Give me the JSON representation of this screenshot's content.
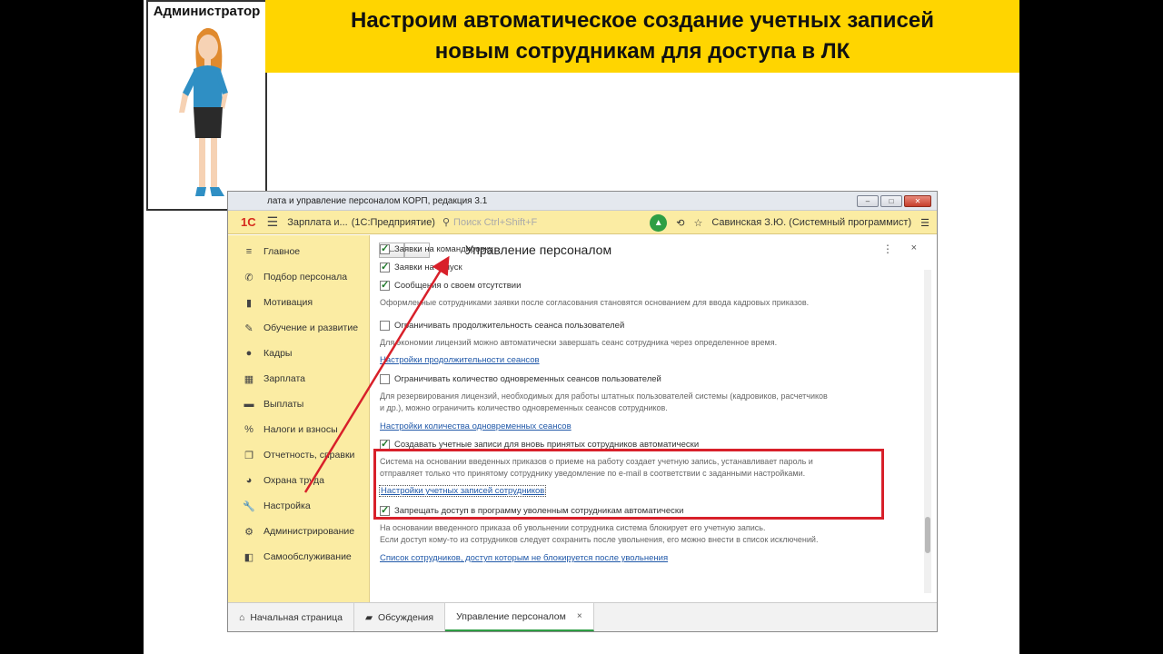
{
  "banner": {
    "line1": "Настроим автоматическое создание учетных записей",
    "line2": "новым сотрудникам для доступа в ЛК"
  },
  "admin_label": "Администратор",
  "window": {
    "title": "лата и управление персоналом КОРП, редакция 3.1",
    "buttons": [
      "‒",
      "□",
      "✕"
    ]
  },
  "toolbar": {
    "logo": "1С",
    "app_name": "Зарплата и...",
    "app_kind": "(1С:Предприятие)",
    "search_placeholder": "Поиск Ctrl+Shift+F",
    "user": "Савинская З.Ю. (Системный программист)"
  },
  "sidebar": {
    "items": [
      {
        "label": "Главное",
        "icon": "≡"
      },
      {
        "label": "Подбор персонала",
        "icon": "✆"
      },
      {
        "label": "Мотивация",
        "icon": "▮"
      },
      {
        "label": "Обучение и развитие",
        "icon": "✎"
      },
      {
        "label": "Кадры",
        "icon": "●"
      },
      {
        "label": "Зарплата",
        "icon": "▦"
      },
      {
        "label": "Выплаты",
        "icon": "▬"
      },
      {
        "label": "Налоги и взносы",
        "icon": "%"
      },
      {
        "label": "Отчетность, справки",
        "icon": "❐"
      },
      {
        "label": "Охрана труда",
        "icon": "◕"
      },
      {
        "label": "Настройка",
        "icon": "🔧"
      },
      {
        "label": "Администрирование",
        "icon": "⚙"
      },
      {
        "label": "Самообслуживание",
        "icon": "◧"
      }
    ]
  },
  "panel": {
    "title": "Управление персоналом",
    "nav_back": "←",
    "nav_forward": "→",
    "more": "⋮",
    "close": "×"
  },
  "settings": {
    "c0": "Заявки на командировку",
    "c1": "Заявки на отпуск",
    "c2": "Сообщения о своем отсутствии",
    "d2": "Оформленные сотрудниками заявки после согласования становятся основанием для ввода кадровых приказов.",
    "c3": "Ограничивать продолжительность сеанса пользователей",
    "d3": "Для экономии лицензий можно автоматически завершать сеанс сотрудника через определенное время.",
    "l3": "Настройки продолжительности сеансов",
    "c4": "Ограничивать количество одновременных сеансов пользователей",
    "d4a": "Для резервирования лицензий, необходимых для работы штатных пользователей системы (кадровиков, расчетчиков",
    "d4b": "и др.), можно ограничить количество одновременных сеансов сотрудников.",
    "l4": "Настройки количества одновременных сеансов",
    "c5": "Создавать учетные записи для вновь принятых сотрудников автоматически",
    "d5a": "Система на основании введенных приказов о приеме на работу создает учетную запись, устанавливает пароль и",
    "d5b": "отправляет только что принятому сотруднику уведомление по e-mail в соответствии с заданными настройками.",
    "l5": "Настройки учетных записей сотрудников",
    "c6": "Запрещать доступ в программу уволенным сотрудникам автоматически",
    "d6a": "На основании введенного приказа об увольнении сотрудника система блокирует его учетную запись.",
    "d6b": "Если доступ кому-то из сотрудников следует сохранить после увольнения, его можно внести в список исключений.",
    "l6": "Список сотрудников, доступ которым не блокируется после увольнения"
  },
  "tabs": [
    {
      "label": "Начальная страница",
      "icon": "⌂"
    },
    {
      "label": "Обсуждения",
      "icon": "▰"
    },
    {
      "label": "Управление персоналом",
      "icon": "",
      "close": "×"
    }
  ],
  "colors": {
    "banner": "#ffd500",
    "sidebar": "#fbeca3",
    "highlight": "#d8202a",
    "link": "#2159a9"
  }
}
